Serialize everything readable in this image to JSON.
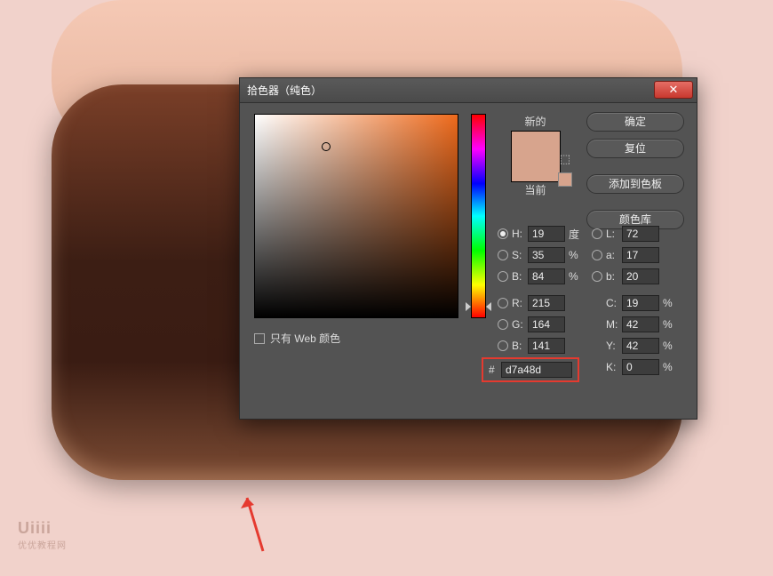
{
  "window": {
    "title": "拾色器（纯色）"
  },
  "buttons": {
    "ok": "确定",
    "cancel": "复位",
    "add_swatch": "添加到色板",
    "color_lib": "颜色库"
  },
  "swatch": {
    "new_label": "新的",
    "current_label": "当前",
    "new_color": "#d7a48d",
    "current_color": "#d7a48d"
  },
  "chart_data": {
    "type": "table",
    "title": "Color values",
    "hsb": {
      "H": 19,
      "S": 35,
      "B": 84,
      "H_unit": "度",
      "S_unit": "%",
      "B_unit": "%"
    },
    "lab": {
      "L": 72,
      "a": 17,
      "b": 20
    },
    "rgb": {
      "R": 215,
      "G": 164,
      "B": 141
    },
    "cmyk": {
      "C": 19,
      "M": 42,
      "Y": 42,
      "K": 0,
      "unit": "%"
    },
    "hex": "d7a48d",
    "selected_model": "H"
  },
  "labels": {
    "H": "H:",
    "S": "S:",
    "B": "B:",
    "L": "L:",
    "a": "a:",
    "b": "b:",
    "R": "R:",
    "G": "G:",
    "Bb": "B:",
    "C": "C:",
    "M": "M:",
    "Y": "Y:",
    "K": "K:",
    "hash": "#",
    "dim_unit": "%"
  },
  "checkbox": {
    "web_only": "只有 Web 颜色"
  },
  "sb_cursor": {
    "left_pct": 35,
    "top_pct": 16
  },
  "hue_cursor": {
    "top_pct": 94.7
  },
  "watermark": {
    "brand": "Uiiii",
    "sub": "优优教程网"
  }
}
